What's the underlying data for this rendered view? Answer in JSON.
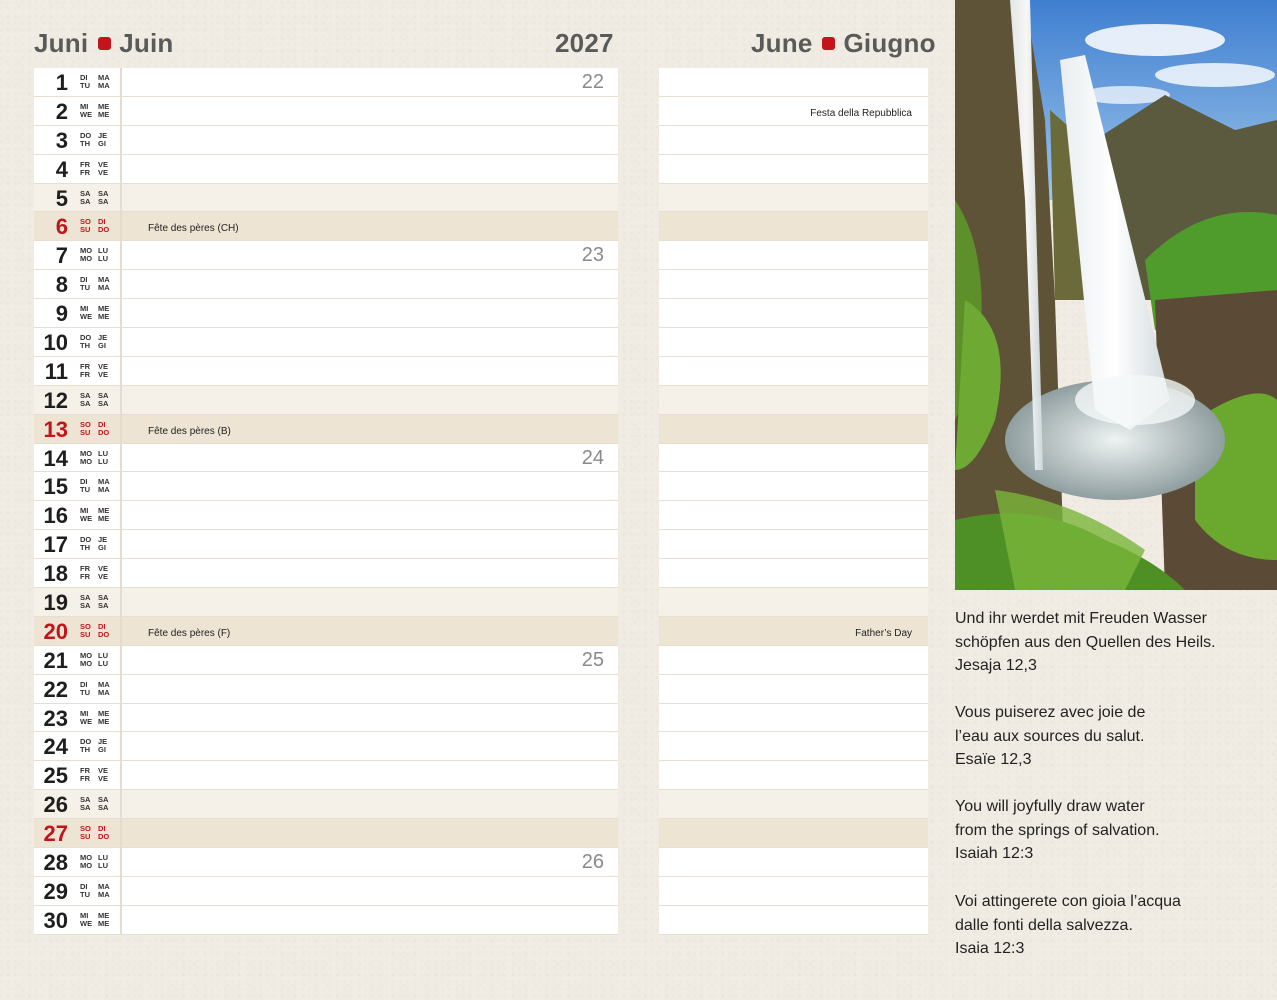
{
  "header": {
    "month_de": "Juni",
    "month_fr": "Juin",
    "year": "2027",
    "month_en": "June",
    "month_it": "Giugno"
  },
  "days": [
    {
      "n": "1",
      "a": [
        "DI",
        "TU",
        "MA",
        "MA"
      ],
      "week": "22",
      "rnote": ""
    },
    {
      "n": "2",
      "a": [
        "MI",
        "WE",
        "ME",
        "ME"
      ],
      "rnote": "Festa della Repubblica"
    },
    {
      "n": "3",
      "a": [
        "DO",
        "TH",
        "JE",
        "GI"
      ]
    },
    {
      "n": "4",
      "a": [
        "FR",
        "FR",
        "VE",
        "VE"
      ]
    },
    {
      "n": "5",
      "a": [
        "SA",
        "SA",
        "SA",
        "SA"
      ],
      "type": "we"
    },
    {
      "n": "6",
      "a": [
        "SO",
        "SU",
        "DI",
        "DO"
      ],
      "type": "sun",
      "note": "Fête des pères (CH)"
    },
    {
      "n": "7",
      "a": [
        "MO",
        "MO",
        "LU",
        "LU"
      ],
      "week": "23"
    },
    {
      "n": "8",
      "a": [
        "DI",
        "TU",
        "MA",
        "MA"
      ]
    },
    {
      "n": "9",
      "a": [
        "MI",
        "WE",
        "ME",
        "ME"
      ]
    },
    {
      "n": "10",
      "a": [
        "DO",
        "TH",
        "JE",
        "GI"
      ]
    },
    {
      "n": "11",
      "a": [
        "FR",
        "FR",
        "VE",
        "VE"
      ]
    },
    {
      "n": "12",
      "a": [
        "SA",
        "SA",
        "SA",
        "SA"
      ],
      "type": "we"
    },
    {
      "n": "13",
      "a": [
        "SO",
        "SU",
        "DI",
        "DO"
      ],
      "type": "sun",
      "note": "Fête des pères (B)"
    },
    {
      "n": "14",
      "a": [
        "MO",
        "MO",
        "LU",
        "LU"
      ],
      "week": "24"
    },
    {
      "n": "15",
      "a": [
        "DI",
        "TU",
        "MA",
        "MA"
      ]
    },
    {
      "n": "16",
      "a": [
        "MI",
        "WE",
        "ME",
        "ME"
      ]
    },
    {
      "n": "17",
      "a": [
        "DO",
        "TH",
        "JE",
        "GI"
      ]
    },
    {
      "n": "18",
      "a": [
        "FR",
        "FR",
        "VE",
        "VE"
      ]
    },
    {
      "n": "19",
      "a": [
        "SA",
        "SA",
        "SA",
        "SA"
      ],
      "type": "we"
    },
    {
      "n": "20",
      "a": [
        "SO",
        "SU",
        "DI",
        "DO"
      ],
      "type": "sun",
      "note": "Fête des pères (F)",
      "rnote": "Father’s Day"
    },
    {
      "n": "21",
      "a": [
        "MO",
        "MO",
        "LU",
        "LU"
      ],
      "week": "25"
    },
    {
      "n": "22",
      "a": [
        "DI",
        "TU",
        "MA",
        "MA"
      ]
    },
    {
      "n": "23",
      "a": [
        "MI",
        "WE",
        "ME",
        "ME"
      ]
    },
    {
      "n": "24",
      "a": [
        "DO",
        "TH",
        "JE",
        "GI"
      ]
    },
    {
      "n": "25",
      "a": [
        "FR",
        "FR",
        "VE",
        "VE"
      ]
    },
    {
      "n": "26",
      "a": [
        "SA",
        "SA",
        "SA",
        "SA"
      ],
      "type": "we"
    },
    {
      "n": "27",
      "a": [
        "SO",
        "SU",
        "DI",
        "DO"
      ],
      "type": "sun"
    },
    {
      "n": "28",
      "a": [
        "MO",
        "MO",
        "LU",
        "LU"
      ],
      "week": "26"
    },
    {
      "n": "29",
      "a": [
        "DI",
        "TU",
        "MA",
        "MA"
      ]
    },
    {
      "n": "30",
      "a": [
        "MI",
        "WE",
        "ME",
        "ME"
      ]
    }
  ],
  "quotes": [
    {
      "lines": [
        "Und ihr werdet mit Freuden Wasser",
        "schöpfen aus den Quellen des Heils.",
        "Jesaja 12,3"
      ]
    },
    {
      "lines": [
        "Vous puiserez avec joie de",
        "l’eau aux sources du salut.",
        "Esaïe 12,3"
      ]
    },
    {
      "lines": [
        "You will joyfully draw water",
        "from the springs of salvation.",
        "Isaiah 12:3"
      ]
    },
    {
      "lines": [
        "Voi attingerete con gioia l’acqua",
        "dalle fonti della salvezza.",
        "Isaia 12:3"
      ]
    }
  ],
  "colors": {
    "accent": "#c3141b",
    "weekend": "#f5f0e8",
    "sunday": "#ede4d3"
  }
}
